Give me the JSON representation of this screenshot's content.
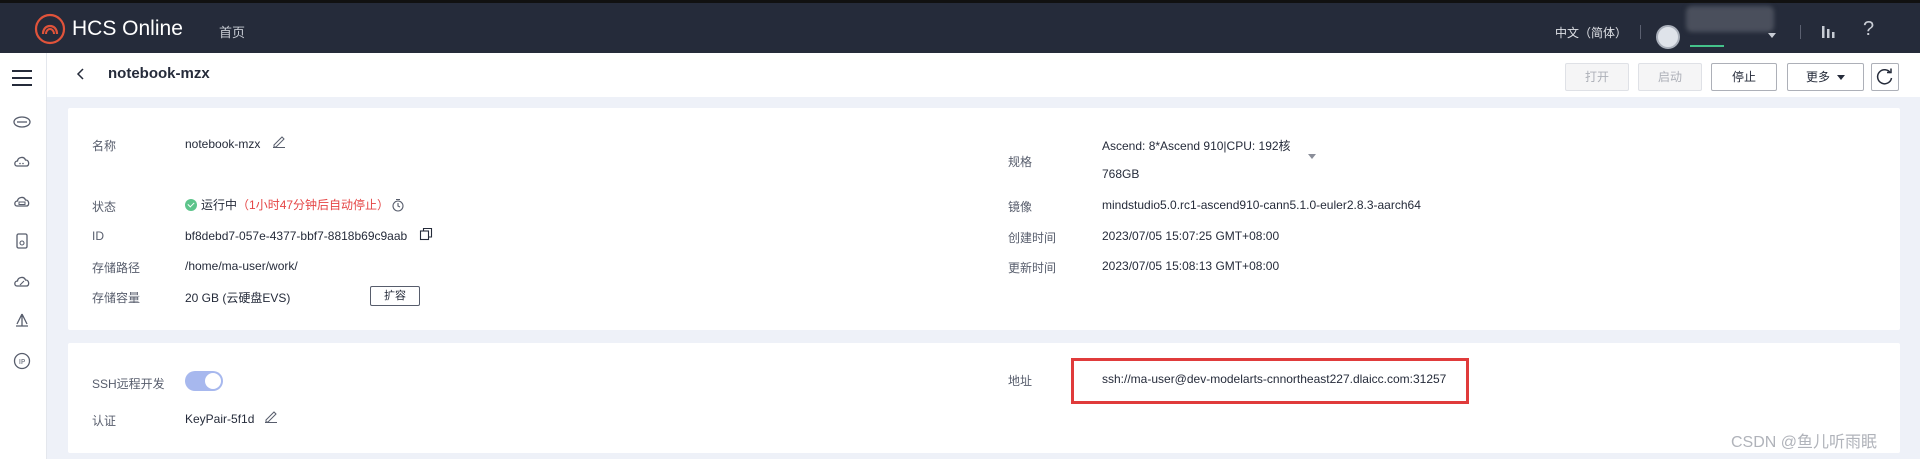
{
  "topbar": {
    "brand": "HCS Online",
    "home": "首页",
    "language": "中文（简体）",
    "help": "?"
  },
  "page": {
    "title": "notebook-mzx",
    "buttons": {
      "open": "打开",
      "start": "启动",
      "stop": "停止",
      "more": "更多"
    }
  },
  "details": {
    "name_label": "名称",
    "name_value": "notebook-mzx",
    "status_label": "状态",
    "status_value": "运行中",
    "status_note": "（1小时47分钟后自动停止）",
    "id_label": "ID",
    "id_value": "bf8debd7-057e-4377-bbf7-8818b69c9aab",
    "path_label": "存储路径",
    "path_value": "/home/ma-user/work/",
    "capacity_label": "存储容量",
    "capacity_value": "20 GB (云硬盘EVS)",
    "expand_label": "扩容",
    "spec_label": "规格",
    "spec_line1": "Ascend: 8*Ascend 910|CPU: 192核",
    "spec_line2": "768GB",
    "image_label": "镜像",
    "image_value": "mindstudio5.0.rc1-ascend910-cann5.1.0-euler2.8.3-aarch64",
    "created_label": "创建时间",
    "created_value": "2023/07/05 15:07:25 GMT+08:00",
    "updated_label": "更新时间",
    "updated_value": "2023/07/05 15:08:13 GMT+08:00"
  },
  "ssh": {
    "remote_label": "SSH远程开发",
    "remote_enabled": true,
    "auth_label": "认证",
    "auth_value": "KeyPair-5f1d",
    "address_label": "地址",
    "address_value": "ssh://ma-user@dev-modelarts-cnnortheast227.dlaicc.com:31257"
  },
  "watermark": "CSDN @鱼儿听雨眠",
  "colors": {
    "topbar": "#252b3a",
    "running": "#5dc48b",
    "warning_text": "#e54545",
    "highlight_box": "#e03b3b",
    "toggle_on": "#a7b8ee"
  }
}
